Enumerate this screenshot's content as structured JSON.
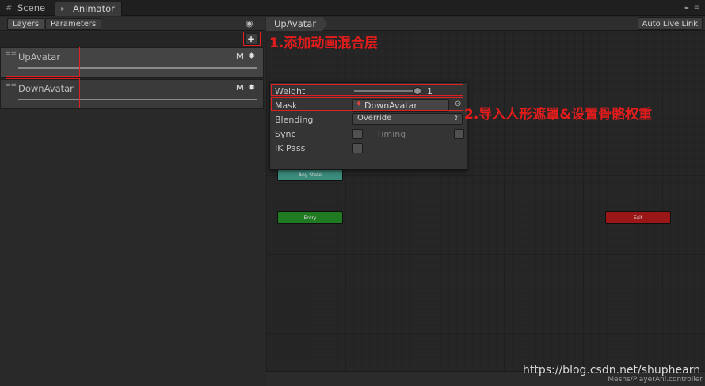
{
  "tabs": {
    "scene": {
      "label": "Scene",
      "icon": "hash-icon"
    },
    "animator": {
      "label": "Animator",
      "icon": "animator-icon"
    }
  },
  "left": {
    "subtabs": {
      "layers": "Layers",
      "parameters": "Parameters"
    },
    "add_button": "+",
    "layers": [
      {
        "name": "UpAvatar",
        "m": "M"
      },
      {
        "name": "DownAvatar",
        "m": "M"
      }
    ]
  },
  "graph": {
    "breadcrumb": "UpAvatar",
    "auto_live_link": "Auto Live Link",
    "states": {
      "any": "Any State",
      "entry": "Entry",
      "exit": "Exit"
    },
    "path": "Meshs/PlayerAni.controller"
  },
  "popup": {
    "weight_label": "Weight",
    "weight_value": "1",
    "mask_label": "Mask",
    "mask_value": "DownAvatar",
    "blending_label": "Blending",
    "blending_value": "Override",
    "sync_label": "Sync",
    "timing_label": "Timing",
    "ikpass_label": "IK Pass"
  },
  "annotations": {
    "a1": "1.添加动画混合层",
    "a2": "2.导入人形遮罩&设置骨骼权重"
  },
  "watermark": "https://blog.csdn.net/shuphearn",
  "colors": {
    "annotation": "#e02020",
    "entry": "#1f7a22",
    "exit": "#9b1616",
    "any_state": "#3b8c7d"
  }
}
